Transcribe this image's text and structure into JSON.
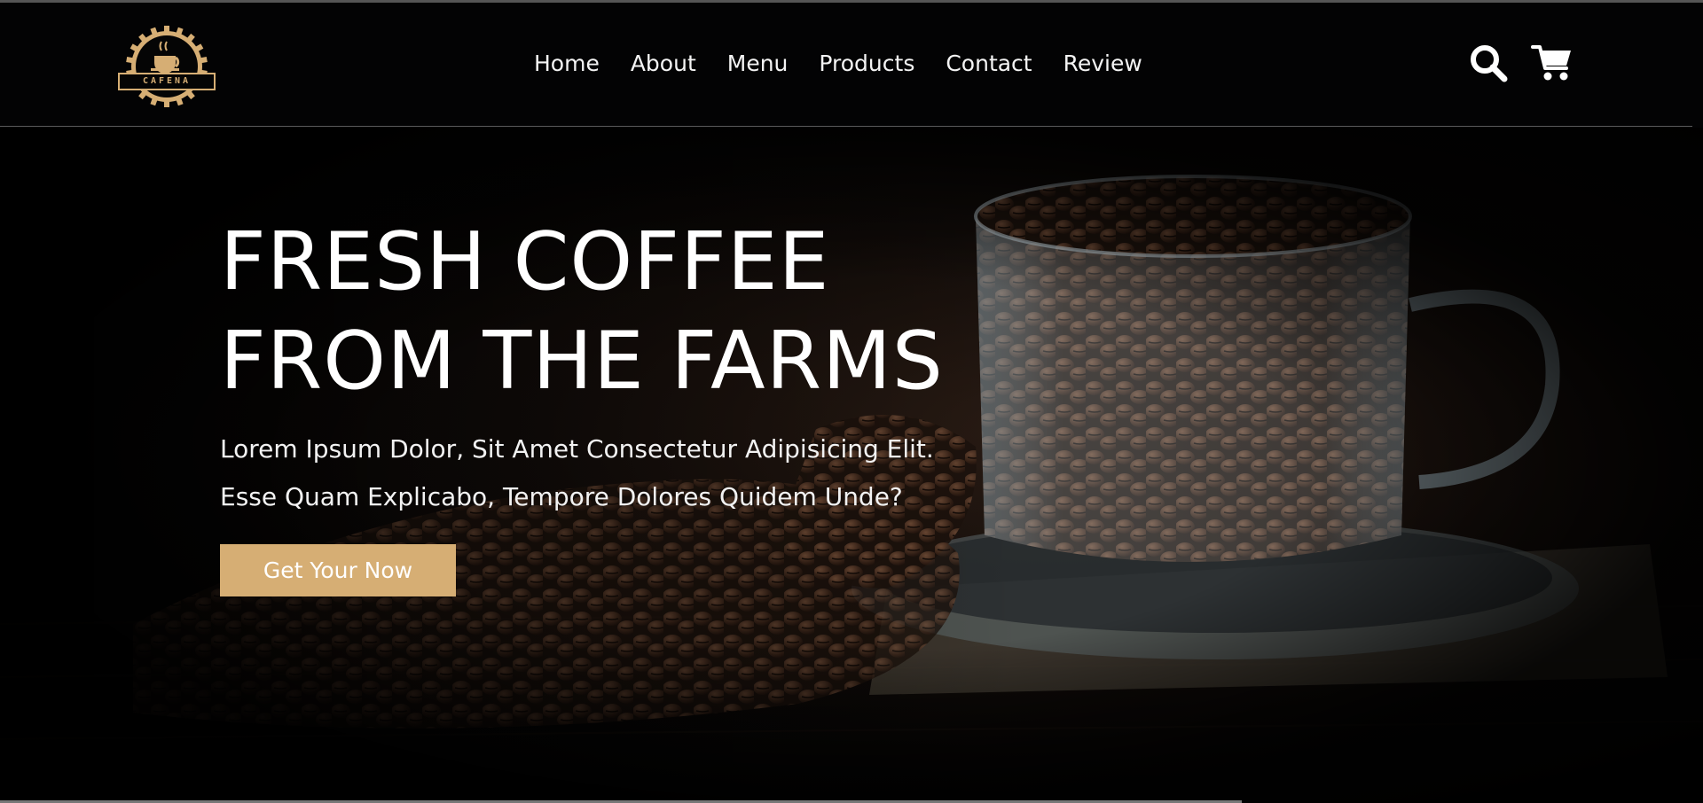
{
  "brand": {
    "logo_text": "CAFENA",
    "logo_icon": "coffee-cup-badge-icon"
  },
  "nav": {
    "items": [
      {
        "label": "Home"
      },
      {
        "label": "About"
      },
      {
        "label": "Menu"
      },
      {
        "label": "Products"
      },
      {
        "label": "Contact"
      },
      {
        "label": "Review"
      }
    ]
  },
  "header_icons": {
    "search": "search-icon",
    "cart": "shopping-cart-icon"
  },
  "hero": {
    "title_line1": "FRESH COFFEE",
    "title_line2": "FROM THE FARMS",
    "desc_line1": "Lorem Ipsum Dolor, Sit Amet Consectetur Adipisicing Elit.",
    "desc_line2": "Esse Quam Explicabo, Tempore Dolores Quidem Unde?",
    "cta_label": "Get Your Now",
    "image": "coffee-beans-glass-cup-photo"
  },
  "colors": {
    "accent": "#d6ae74",
    "background": "#030304",
    "text": "#ffffff"
  }
}
